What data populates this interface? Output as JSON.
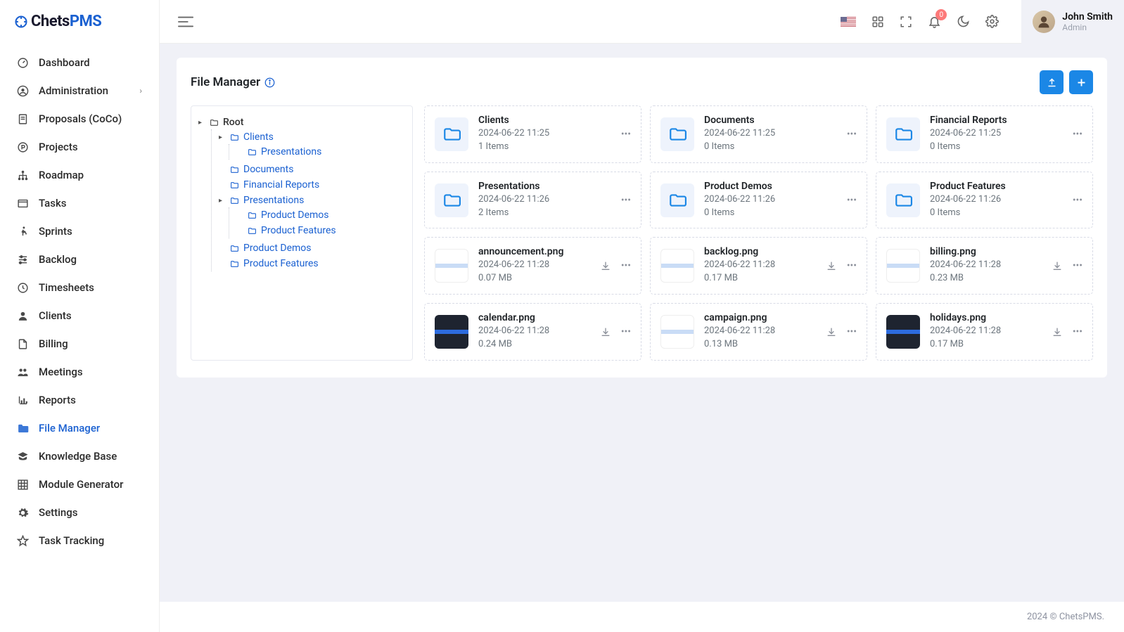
{
  "brand": {
    "name_a": "Chets",
    "name_b": "PMS"
  },
  "user": {
    "name": "John Smith",
    "role": "Admin"
  },
  "notif_count": "0",
  "sidebar": [
    {
      "id": "dashboard",
      "label": "Dashboard",
      "icon": "gauge"
    },
    {
      "id": "administration",
      "label": "Administration",
      "icon": "user-circle",
      "expandable": true
    },
    {
      "id": "proposals",
      "label": "Proposals (CoCo)",
      "icon": "doc"
    },
    {
      "id": "projects",
      "label": "Projects",
      "icon": "p-circle"
    },
    {
      "id": "roadmap",
      "label": "Roadmap",
      "icon": "sitemap"
    },
    {
      "id": "tasks",
      "label": "Tasks",
      "icon": "window"
    },
    {
      "id": "sprints",
      "label": "Sprints",
      "icon": "run"
    },
    {
      "id": "backlog",
      "label": "Backlog",
      "icon": "sliders"
    },
    {
      "id": "timesheets",
      "label": "Timesheets",
      "icon": "clock"
    },
    {
      "id": "clients",
      "label": "Clients",
      "icon": "user"
    },
    {
      "id": "billing",
      "label": "Billing",
      "icon": "file"
    },
    {
      "id": "meetings",
      "label": "Meetings",
      "icon": "group"
    },
    {
      "id": "reports",
      "label": "Reports",
      "icon": "chart"
    },
    {
      "id": "file-manager",
      "label": "File Manager",
      "icon": "folder",
      "active": true
    },
    {
      "id": "knowledge-base",
      "label": "Knowledge Base",
      "icon": "grad"
    },
    {
      "id": "module-generator",
      "label": "Module Generator",
      "icon": "grid"
    },
    {
      "id": "settings",
      "label": "Settings",
      "icon": "gear"
    },
    {
      "id": "task-tracking",
      "label": "Task Tracking",
      "icon": "star"
    }
  ],
  "page": {
    "title": "File Manager"
  },
  "tree": {
    "root": "Root",
    "nodes": [
      {
        "label": "Clients",
        "children": [
          {
            "label": "Presentations"
          }
        ]
      },
      {
        "label": "Documents"
      },
      {
        "label": "Financial Reports"
      },
      {
        "label": "Presentations",
        "children": [
          {
            "label": "Product Demos"
          },
          {
            "label": "Product Features"
          }
        ]
      },
      {
        "label": "Product Demos"
      },
      {
        "label": "Product Features"
      }
    ]
  },
  "items": [
    {
      "type": "folder",
      "name": "Clients",
      "date": "2024-06-22 11:25",
      "meta2": "1 Items"
    },
    {
      "type": "folder",
      "name": "Documents",
      "date": "2024-06-22 11:25",
      "meta2": "0 Items"
    },
    {
      "type": "folder",
      "name": "Financial Reports",
      "date": "2024-06-22 11:25",
      "meta2": "0 Items"
    },
    {
      "type": "folder",
      "name": "Presentations",
      "date": "2024-06-22 11:26",
      "meta2": "2 Items"
    },
    {
      "type": "folder",
      "name": "Product Demos",
      "date": "2024-06-22 11:26",
      "meta2": "0 Items"
    },
    {
      "type": "folder",
      "name": "Product Features",
      "date": "2024-06-22 11:26",
      "meta2": "0 Items"
    },
    {
      "type": "file",
      "thumb": "light",
      "name": "announcement.png",
      "date": "2024-06-22 11:28",
      "meta2": "0.07 MB"
    },
    {
      "type": "file",
      "thumb": "light",
      "name": "backlog.png",
      "date": "2024-06-22 11:28",
      "meta2": "0.17 MB"
    },
    {
      "type": "file",
      "thumb": "light",
      "name": "billing.png",
      "date": "2024-06-22 11:28",
      "meta2": "0.23 MB"
    },
    {
      "type": "file",
      "thumb": "dark",
      "name": "calendar.png",
      "date": "2024-06-22 11:28",
      "meta2": "0.24 MB"
    },
    {
      "type": "file",
      "thumb": "light",
      "name": "campaign.png",
      "date": "2024-06-22 11:28",
      "meta2": "0.13 MB"
    },
    {
      "type": "file",
      "thumb": "dark",
      "name": "holidays.png",
      "date": "2024-06-22 11:28",
      "meta2": "0.17 MB"
    }
  ],
  "footer": "2024 © ChetsPMS."
}
